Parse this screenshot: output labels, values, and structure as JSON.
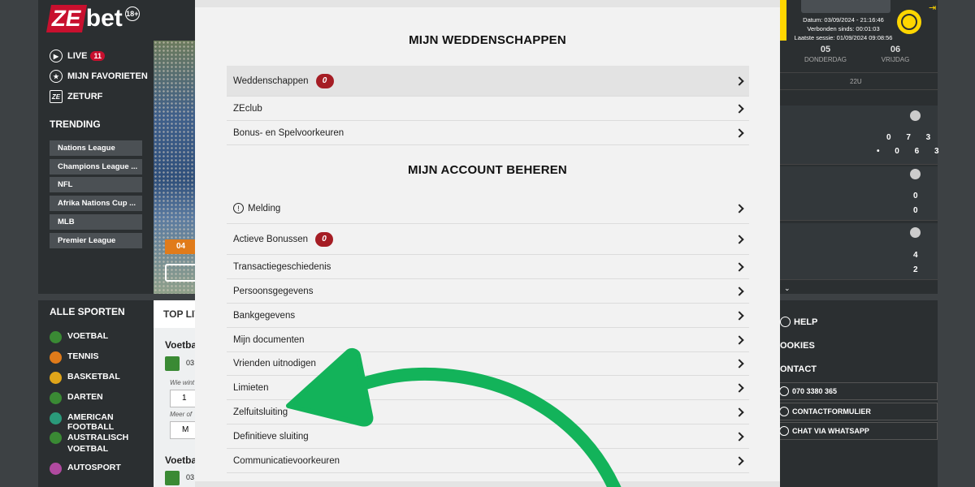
{
  "brand": {
    "logo_ze": "ZE",
    "logo_bet": "bet",
    "age_badge": "18+"
  },
  "sidebar": {
    "nav": [
      {
        "label": "LIVE",
        "badge": "11",
        "icon": "play-icon"
      },
      {
        "label": "MIJN FAVORIETEN",
        "icon": "star-icon"
      },
      {
        "label": "ZETURF",
        "icon": "zeturf-icon"
      }
    ],
    "trending_title": "TRENDING",
    "trending": [
      "Nations League",
      "Champions League ...",
      "NFL",
      "Afrika Nations Cup ...",
      "MLB",
      "Premier League"
    ]
  },
  "sports": {
    "title": "ALLE SPORTEN",
    "items": [
      {
        "label": "VOETBAL",
        "color": "#3a8a34"
      },
      {
        "label": "TENNIS",
        "color": "#e07b1a"
      },
      {
        "label": "BASKETBAL",
        "color": "#e0a51a"
      },
      {
        "label": "DARTEN",
        "color": "#3a8a34"
      },
      {
        "label": "AMERICAN FOOTBALL",
        "color": "#2a9a7a"
      },
      {
        "label": "AUSTRALISCH VOETBAL",
        "color": "#3a8a34"
      },
      {
        "label": "AUTOSPORT",
        "color": "#b04aa0"
      }
    ]
  },
  "toplive": {
    "heading": "TOP LIV",
    "section1": "Voetba",
    "section2": "Voetba",
    "code1": "03",
    "code2": "03",
    "small1": "Wie wint",
    "small2": "Meer of",
    "box1": "1",
    "box2": "M"
  },
  "hero": {
    "badge_text": "04"
  },
  "session": {
    "datum": "Datum: 03/09/2024 - 21:16:46",
    "verbonden": "Verbonden sinds: 00:01:03",
    "laatste": "Laatste sessie: 01/09/2024 09:08:56"
  },
  "calendar": {
    "days": [
      {
        "num": "05",
        "name": "DONDERDAG"
      },
      {
        "num": "06",
        "name": "VRIJDAG"
      }
    ],
    "hour": "22U"
  },
  "scores": [
    {
      "a": "0 7 3",
      "b": "• 0 6 3"
    },
    {
      "a": "0",
      "b": "0"
    },
    {
      "a": "4",
      "b": "2"
    }
  ],
  "help": {
    "help": "HELP",
    "cookies": "OOKIES",
    "contact": "ONTACT",
    "phone": "070 3380 365",
    "form": "CONTACTFORMULIER",
    "whatsapp": "CHAT VIA WHATSAPP"
  },
  "modal": {
    "section1_title": "MIJN WEDDENSCHAPPEN",
    "section1_items": [
      {
        "label": "Weddenschappen",
        "badge": "0"
      },
      {
        "label": "ZEclub"
      },
      {
        "label": "Bonus- en Spelvoorkeuren"
      }
    ],
    "section2_title": "MIJN ACCOUNT BEHEREN",
    "section2_items": [
      {
        "label": "Melding",
        "icon": "info-icon"
      },
      {
        "label": "Actieve Bonussen",
        "badge": "0"
      },
      {
        "label": "Transactiegeschiedenis"
      },
      {
        "label": "Persoonsgegevens"
      },
      {
        "label": "Bankgegevens"
      },
      {
        "label": "Mijn documenten"
      },
      {
        "label": "Vrienden uitnodigen"
      },
      {
        "label": "Limieten"
      },
      {
        "label": "Zelfuitsluiting"
      },
      {
        "label": "Definitieve sluiting"
      },
      {
        "label": "Communicatievoorkeuren"
      }
    ]
  },
  "colors": {
    "accent_red": "#a51d24",
    "brand_yellow": "#ffd600",
    "arrow_green": "#13b35a"
  }
}
